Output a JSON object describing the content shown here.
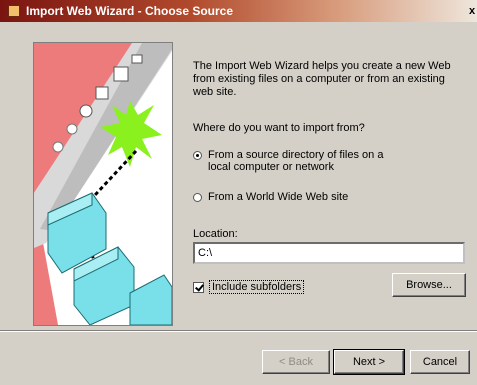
{
  "window": {
    "title": "Import Web Wizard - Choose Source",
    "close_glyph": "x"
  },
  "intro_text": "The Import Web Wizard helps you create a new Web from existing files on a computer or from an existing web site.",
  "question": "Where do you want to import from?",
  "options": {
    "local": {
      "label": "From a source directory of files on a local computer or network",
      "selected": true
    },
    "www": {
      "label": "From a World Wide Web site",
      "selected": false
    }
  },
  "location": {
    "label": "Location:",
    "value": "C:\\"
  },
  "include_subfolders": {
    "label": "Include subfolders",
    "checked": true
  },
  "buttons": {
    "browse": "Browse...",
    "back": "< Back",
    "next": "Next >",
    "cancel": "Cancel"
  },
  "colors": {
    "dialog_bg": "#d4d0c8",
    "art_red": "#ee7b7b",
    "art_cyan": "#79dfe8",
    "art_green": "#8af01e"
  }
}
